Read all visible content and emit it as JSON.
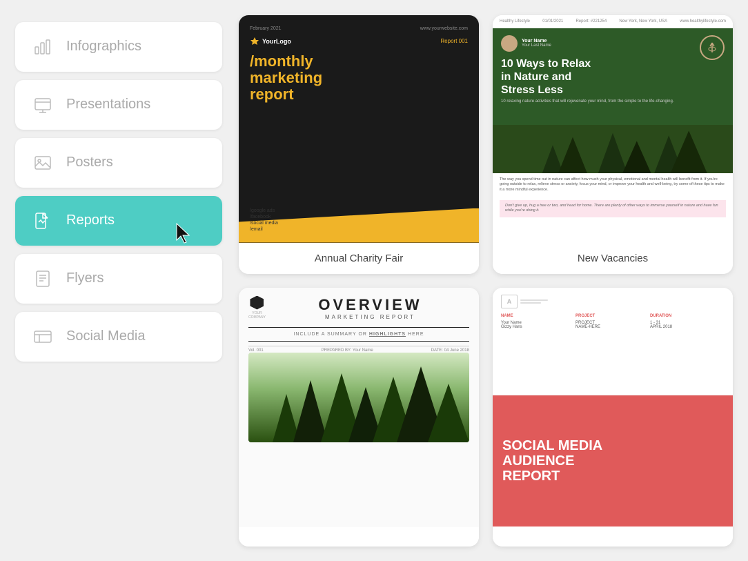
{
  "sidebar": {
    "items": [
      {
        "id": "infographics",
        "label": "Infographics",
        "icon": "bar-chart-icon",
        "active": false
      },
      {
        "id": "presentations",
        "label": "Presentations",
        "icon": "presentation-icon",
        "active": false
      },
      {
        "id": "posters",
        "label": "Posters",
        "icon": "image-icon",
        "active": false
      },
      {
        "id": "reports",
        "label": "Reports",
        "icon": "reports-icon",
        "active": true
      },
      {
        "id": "flyers",
        "label": "Flyers",
        "icon": "flyer-icon",
        "active": false
      },
      {
        "id": "social-media",
        "label": "Social Media",
        "icon": "social-icon",
        "active": false
      }
    ]
  },
  "cards": [
    {
      "id": "monthly-marketing",
      "label": "Annual Charity Fair",
      "preview": {
        "date": "February 2021",
        "website": "www.yourwebsite.com",
        "logo": "YourLogo",
        "report_num": "Report 001",
        "title": "/monthly\nmarketing\nreport",
        "links": [
          "/google ads",
          "/facebook",
          "/social media",
          "/email"
        ]
      }
    },
    {
      "id": "relax-nature",
      "label": "New Vacancies",
      "preview": {
        "brand": "Healthy Lifestyle",
        "website": "www.healthylifestyle.com",
        "date": "01/01/2021",
        "report_num": "Report: #221254",
        "location": "New York, New York, USA",
        "name": "Your Name",
        "lastname": "Your Last Name",
        "title": "10 Ways to Relax in Nature and Stress Less",
        "subtitle": "10 relaxing nature activities that will rejuvenate your mind, from the simple to the life-changing."
      }
    },
    {
      "id": "overview-marketing",
      "label": "",
      "preview": {
        "company": "YOUR\nCOMPANY",
        "title": "OVERVIEW",
        "subtitle": "MARKETING REPORT",
        "highlights_text": "INCLUDE A SUMMARY OR HIGHLIGHTS HERE",
        "vol": "Vol. 001",
        "prepared_by": "PREPARED BY: Your Name",
        "date": "DATE: 04 June 2018"
      }
    },
    {
      "id": "social-media-audience",
      "label": "",
      "preview": {
        "logo_letter": "A",
        "name_label": "NAME",
        "project_label": "PROJECT",
        "duration_label": "DURATION",
        "name_val": "Your Name\nGizzy Hans",
        "project_val": "PROJECT\nNAME-HERE",
        "duration_val": "1 - 31\nAPRIL 2018",
        "report_title": "SOCIAL MEDIA\nAUDIENCE\nREPORT"
      }
    }
  ]
}
